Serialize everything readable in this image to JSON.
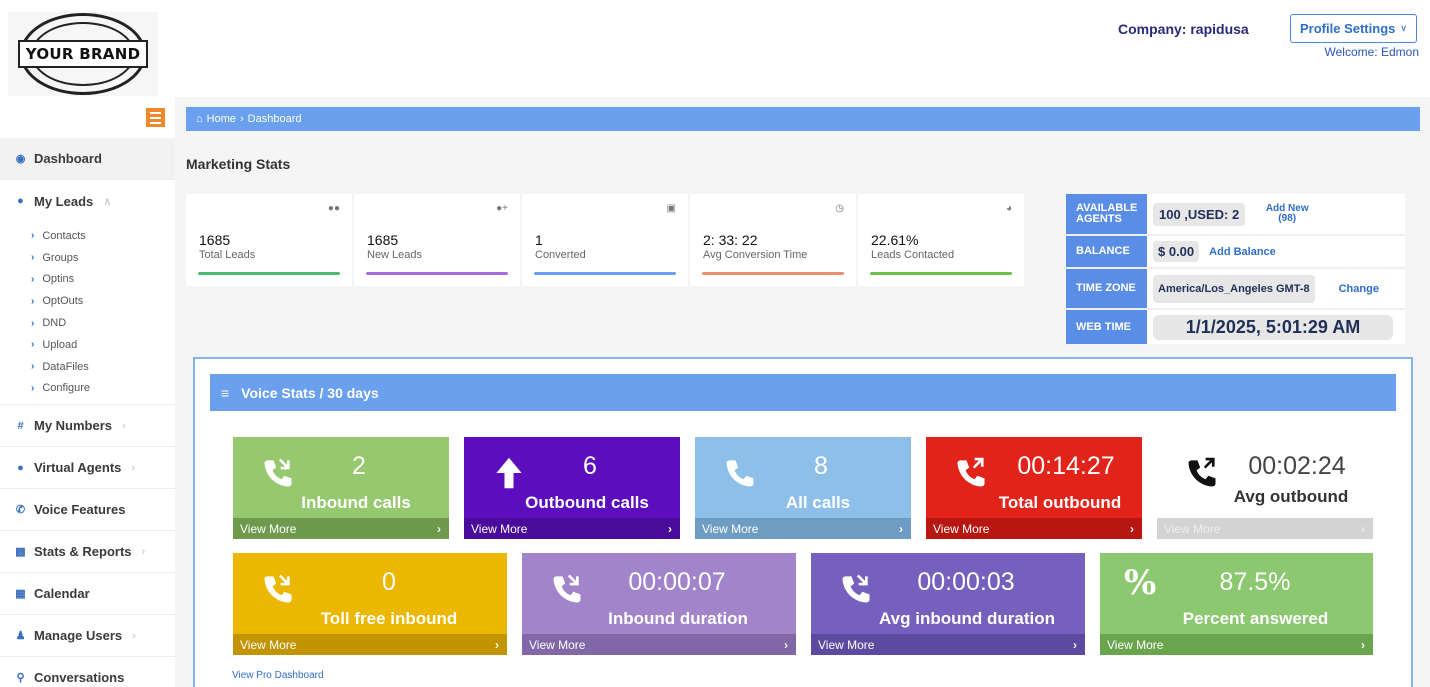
{
  "brand": {
    "logo_text": "YOUR BRAND"
  },
  "header": {
    "company": "Company: rapidusa",
    "profile_button": "Profile Settings",
    "welcome": "Welcome: Edmon"
  },
  "sidebar": {
    "items": [
      {
        "label": "Dashboard",
        "icon": "dashboard-icon"
      },
      {
        "label": "My Leads",
        "icon": "users-icon"
      },
      {
        "label": "My Numbers",
        "icon": "hash-icon"
      },
      {
        "label": "Virtual Agents",
        "icon": "users-icon"
      },
      {
        "label": "Voice Features",
        "icon": "phone-icon"
      },
      {
        "label": "Stats & Reports",
        "icon": "bar-chart-icon"
      },
      {
        "label": "Calendar",
        "icon": "calendar-icon"
      },
      {
        "label": "Manage Users",
        "icon": "user-tree-icon"
      },
      {
        "label": "Conversations",
        "icon": "chat-icon"
      }
    ],
    "lead_subitems": [
      "Contacts",
      "Groups",
      "Optins",
      "OptOuts",
      "DND",
      "Upload",
      "DataFiles",
      "Configure"
    ]
  },
  "breadcrumb": {
    "home": "Home",
    "current": "Dashboard"
  },
  "marketing": {
    "title": "Marketing Stats",
    "cards": [
      {
        "value": "1685",
        "label": "Total Leads",
        "color": "#4cbb6e",
        "icon": "users-icon"
      },
      {
        "value": "1685",
        "label": "New Leads",
        "color": "#a66ddf",
        "icon": "user-add-icon"
      },
      {
        "value": "1",
        "label": "Converted",
        "color": "#6a9ff0",
        "icon": "cart-icon"
      },
      {
        "value": "2: 33: 22",
        "label": "Avg Conversion Time",
        "color": "#e9916c",
        "icon": "clock-icon"
      },
      {
        "value": "22.61%",
        "label": "Leads Contacted",
        "color": "#6cc14f",
        "icon": "pie-chart-icon"
      }
    ]
  },
  "info": {
    "agents_key": "AVAILABLE AGENTS",
    "agents_val": "100 ,USED: 2",
    "agents_link": "Add New (98)",
    "balance_key": "BALANCE",
    "balance_val": "$ 0.00",
    "balance_link": "Add Balance",
    "tz_key": "TIME ZONE",
    "tz_val": "America/Los_Angeles GMT-8",
    "tz_link": "Change",
    "web_key": "WEB TIME",
    "web_val": "1/1/2025, 5:01:29 AM"
  },
  "voice": {
    "title": "Voice Stats / 30 days",
    "view_more": "View More",
    "tiles": [
      {
        "value": "2",
        "label": "Inbound calls",
        "icon": "phone-incoming-icon",
        "bg": "#96c96f",
        "foot": "#6f9a4d"
      },
      {
        "value": "6",
        "label": "Outbound calls",
        "icon": "arrow-up-icon",
        "bg": "#5c0ebf",
        "foot": "#4a0a9a"
      },
      {
        "value": "8",
        "label": "All calls",
        "icon": "phone-icon",
        "bg": "#8dbfe9",
        "foot": "#6e9cc2"
      },
      {
        "value": "00:14:27",
        "label": "Total outbound",
        "icon": "phone-outgoing-icon",
        "bg": "#e2231a",
        "foot": "#b81610"
      },
      {
        "value": "00:02:24",
        "label": "Avg outbound",
        "icon": "phone-outgoing-icon",
        "bg": "#ffffff",
        "foot": "#d3d3d3"
      },
      {
        "value": "0",
        "label": "Toll free inbound",
        "icon": "phone-incoming-icon",
        "bg": "#ebb700",
        "foot": "#c19400"
      },
      {
        "value": "00:00:07",
        "label": "Inbound duration",
        "icon": "phone-incoming-icon",
        "bg": "#a184ca",
        "foot": "#8167a8"
      },
      {
        "value": "00:00:03",
        "label": "Avg inbound duration",
        "icon": "phone-incoming-icon",
        "bg": "#7560bd",
        "foot": "#5c4aa0"
      },
      {
        "value": "87.5%",
        "label": "Percent answered",
        "icon": "percent-icon",
        "bg": "#8bc86f",
        "foot": "#6aa54d"
      }
    ],
    "pro_link": "View Pro Dashboard"
  }
}
